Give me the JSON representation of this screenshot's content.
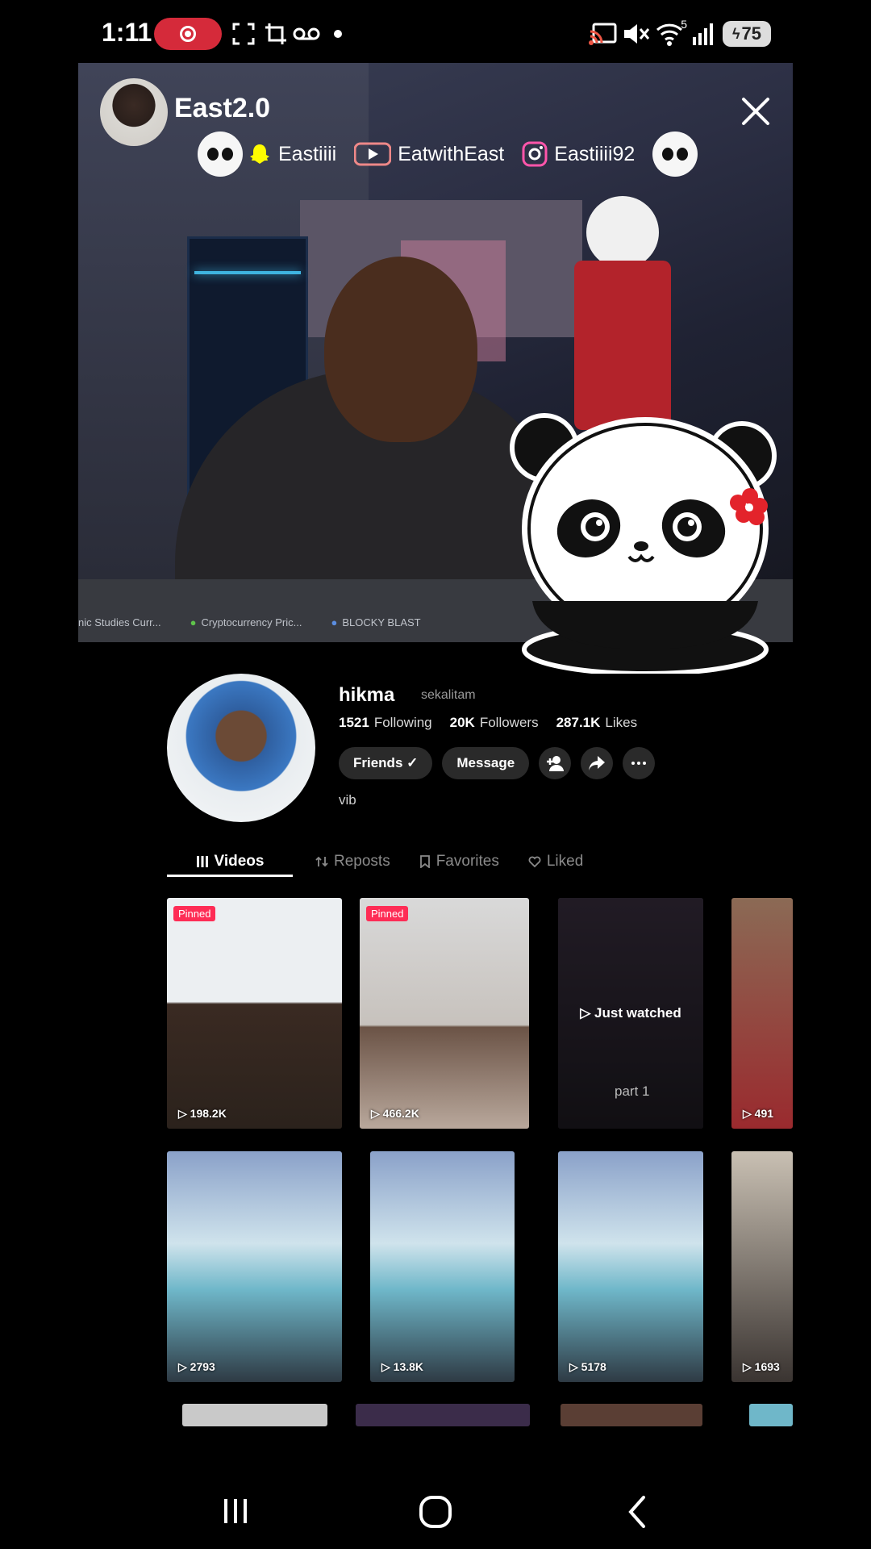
{
  "status_bar": {
    "time": "1:11",
    "battery": "75",
    "network_superscript": "5"
  },
  "stream": {
    "host_name": "East2.0",
    "socials": [
      {
        "platform_icon": "snapchat-icon",
        "label": "Eastiiii"
      },
      {
        "platform_icon": "youtube-icon",
        "label": "EatwithEast"
      },
      {
        "platform_icon": "instagram-icon",
        "label": "Eastiiii92"
      }
    ],
    "browser_tabs": [
      "nic Studies Curr...",
      "Cryptocurrency Pric...",
      "BLOCKY BLAST"
    ]
  },
  "profile": {
    "name": "hikma",
    "handle": "sekalitam",
    "stats": [
      {
        "value": "1521",
        "label": "Following"
      },
      {
        "value": "20K",
        "label": "Followers"
      },
      {
        "value": "287.1K",
        "label": "Likes"
      }
    ],
    "actions": {
      "friends_label": "Friends ✓",
      "message_label": "Message"
    },
    "bio": "vib"
  },
  "tabs": [
    {
      "label": "Videos",
      "icon": "grid-icon"
    },
    {
      "label": "Reposts",
      "icon": "repost-icon"
    },
    {
      "label": "Favorites",
      "icon": "bookmark-icon"
    },
    {
      "label": "Liked",
      "icon": "heart-icon"
    }
  ],
  "videos": {
    "row1": [
      {
        "views": "198.2K",
        "pinned": "Pinned"
      },
      {
        "views": "466.2K",
        "pinned": "Pinned"
      },
      {
        "views": "",
        "overlay": "▷ Just watched",
        "caption": "part 1"
      },
      {
        "views": "491"
      }
    ],
    "row2": [
      {
        "views": "2793"
      },
      {
        "views": "13.8K"
      },
      {
        "views": "5178"
      },
      {
        "views": "1693"
      }
    ]
  },
  "colors": {
    "accent_red": "#fe2c55",
    "record_red": "#d52a3a"
  }
}
